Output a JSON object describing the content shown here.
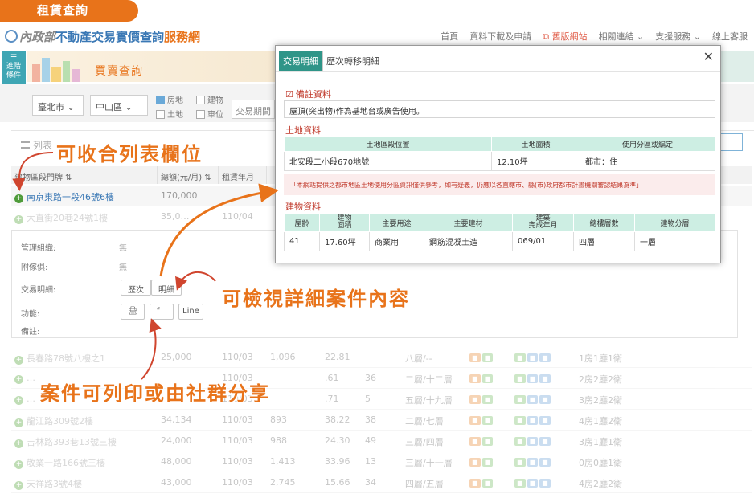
{
  "tag": "租賃查詢",
  "site": {
    "part1": "內政部",
    "part2": "不動產交易實價查詢",
    "part3": "服務網"
  },
  "nav": [
    "首頁",
    "資料下載及申請",
    "舊版網站",
    "相關連結",
    "支援服務",
    "線上客服"
  ],
  "sidebar_btn": "進階\n條件",
  "banner_title": "買賣查詢",
  "filters": {
    "city": "臺北市",
    "district": "中山區",
    "checkboxes": [
      {
        "label": "房地",
        "checked": true
      },
      {
        "label": "建物",
        "checked": false
      },
      {
        "label": "土地",
        "checked": false
      },
      {
        "label": "車位",
        "checked": false
      }
    ],
    "period_btn": "交易期間"
  },
  "list_tab": "列表",
  "thead": [
    "建物區段門牌",
    "總額(元/月)",
    "租賃年月",
    "",
    "",
    "",
    "",
    "",
    ""
  ],
  "rows": [
    {
      "addr": "南京東路一段46號6樓",
      "price": "170,000",
      "date": "",
      "selected": true
    },
    {
      "addr": "大直街20巷24號1樓",
      "price": "35,0…",
      "date": "110/04",
      "selected": false
    }
  ],
  "detail": {
    "labels": [
      "管理組織:",
      "附傢俱:",
      "交易明細:",
      "功能:",
      "備註:"
    ],
    "values": [
      "無",
      "無"
    ],
    "buttons": [
      "歷次",
      "明細"
    ],
    "share": [
      "🖨",
      "f",
      "Line"
    ]
  },
  "more_rows": [
    {
      "addr": "長春路78號八樓之1",
      "price": "25,000",
      "date": "110/03",
      "area": "1,096",
      "unit": "22.81",
      "age": "",
      "floor": "八層/--",
      "layout": "1房1廳1衛"
    },
    {
      "addr": "…",
      "price": "",
      "date": "110/03",
      "area": "",
      "unit": ".61",
      "age": "36",
      "floor": "二層/十二層",
      "layout": "2房2廳2衛"
    },
    {
      "addr": "…",
      "price": "",
      "date": "110/03",
      "area": "",
      "unit": ".71",
      "age": "5",
      "floor": "五層/十九層",
      "layout": "3房2廳2衛"
    },
    {
      "addr": "龍江路309號2樓",
      "price": "34,134",
      "date": "110/03",
      "area": "893",
      "unit": "38.22",
      "age": "38",
      "floor": "二層/七層",
      "layout": "4房1廳2衛"
    },
    {
      "addr": "吉林路393巷13號三樓",
      "price": "24,000",
      "date": "110/03",
      "area": "988",
      "unit": "24.30",
      "age": "49",
      "floor": "三層/四層",
      "layout": "3房1廳1衛"
    },
    {
      "addr": "敬業一路166號三樓",
      "price": "48,000",
      "date": "110/03",
      "area": "1,413",
      "unit": "33.96",
      "age": "13",
      "floor": "三層/十一層",
      "layout": "0房0廳1衛"
    },
    {
      "addr": "天祥路3號4樓",
      "price": "43,000",
      "date": "110/03",
      "area": "2,745",
      "unit": "15.66",
      "age": "34",
      "floor": "四層/五層",
      "layout": "4房2廳2衛"
    }
  ],
  "modal": {
    "tabs": [
      "交易明細",
      "歷次轉移明細"
    ],
    "close": "✕",
    "sec1": "備註資料",
    "note": "屋頂(突出物)作為基地台或廣告使用。",
    "sec2": "土地資料",
    "land_head": [
      "土地區段位置",
      "土地面積",
      "使用分區或編定"
    ],
    "land_row": [
      "北安段二小段670地號",
      "12.10坪",
      "都市：住"
    ],
    "warning": "「本網站提供之都市地區土地使用分區資訊僅供參考，如有疑義，仍應以各直轄市、縣(市)政府都市計畫機關審認結果為準」",
    "sec3": "建物資料",
    "bld_head": [
      "屋齡",
      "建物\n面積",
      "主要用途",
      "主要建材",
      "建築\n完成年月",
      "總樓層數",
      "建物分層"
    ],
    "bld_row": [
      "41",
      "17.60坪",
      "商業用",
      "鋼筋混凝土造",
      "069/01",
      "四層",
      "一層"
    ]
  },
  "annotations": {
    "a1": "可收合列表欄位",
    "a2": "可檢視詳細案件內容",
    "a3": "案件可列印或由社群分享"
  }
}
